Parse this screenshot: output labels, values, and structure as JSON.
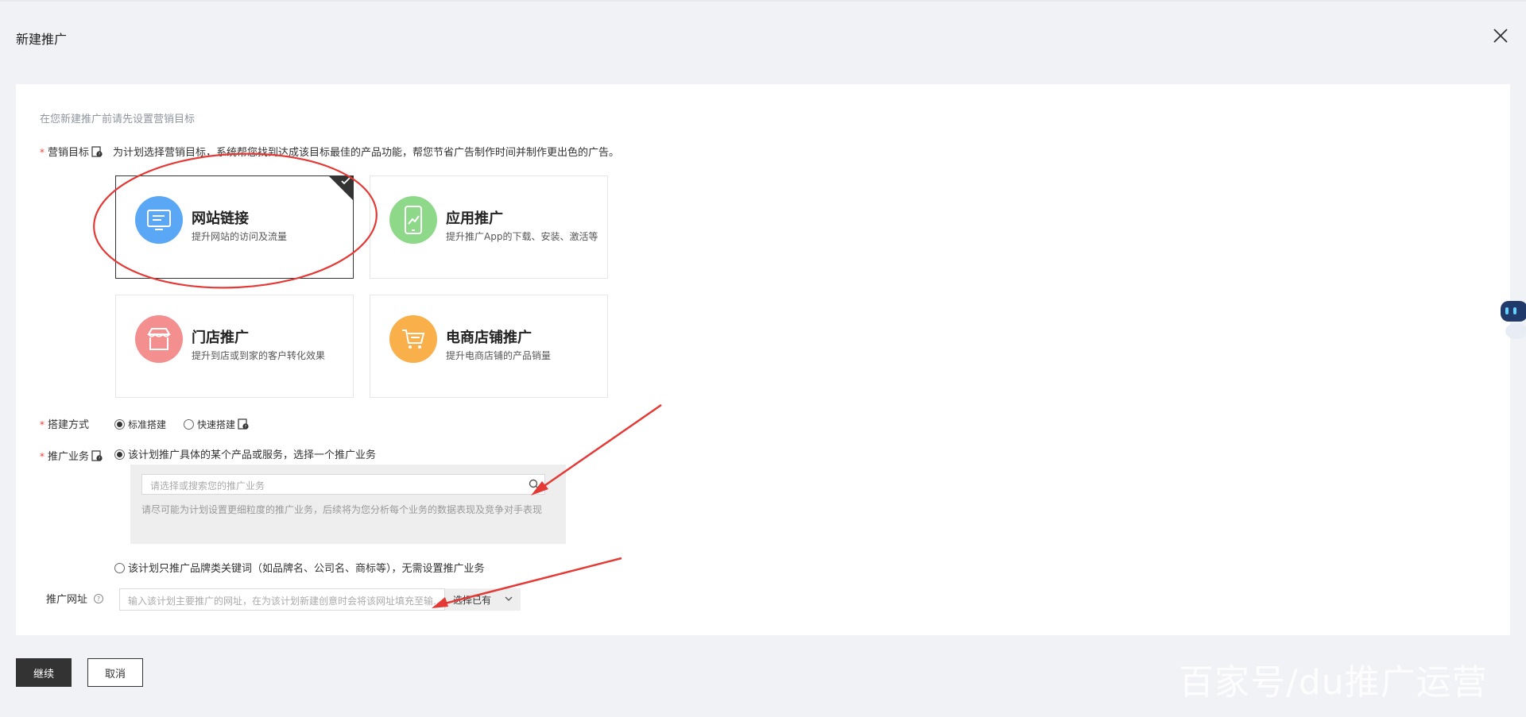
{
  "modal": {
    "title": "新建推广",
    "subtitle": "在您新建推广前请先设置营销目标"
  },
  "goal": {
    "label": "营销目标",
    "description": "为计划选择营销目标，系统帮您找到达成该目标最佳的产品功能，帮您节省广告制作时间并制作更出色的广告。",
    "cards": [
      {
        "title": "网站链接",
        "desc": "提升网站的访问及流量",
        "icon": "monitor-icon",
        "color": "#5aa7f5",
        "selected": true
      },
      {
        "title": "应用推广",
        "desc": "提升推广App的下载、安装、激活等",
        "icon": "mobile-icon",
        "color": "#8ed88a",
        "selected": false
      },
      {
        "title": "门店推广",
        "desc": "提升到店或到家的客户转化效果",
        "icon": "store-icon",
        "color": "#f48f8f",
        "selected": false
      },
      {
        "title": "电商店铺推广",
        "desc": "提升电商店铺的产品销量",
        "icon": "cart-icon",
        "color": "#f9b04a",
        "selected": false
      }
    ]
  },
  "build": {
    "label": "搭建方式",
    "options": [
      "标准搭建",
      "快速搭建"
    ],
    "selected": "标准搭建"
  },
  "business": {
    "label": "推广业务",
    "option1": "该计划推广具体的某个产品或服务，选择一个推广业务",
    "input_placeholder": "请选择或搜索您的推广业务",
    "hint": "请尽可能为计划设置更细粒度的推广业务，后续将为您分析每个业务的数据表现及竞争对手表现",
    "option2": "该计划只推广品牌类关键词（如品牌名、公司名、商标等），无需设置推广业务"
  },
  "url": {
    "label": "推广网址",
    "placeholder": "输入该计划主要推广的网址，在为该计划新建创意时会将该网址填充至输...",
    "select_label": "选择已有"
  },
  "buttons": {
    "continue": "继续",
    "cancel": "取消"
  },
  "watermark": "百家号/du推广运营",
  "colors": {
    "annotation_red": "#e53935",
    "primary_button": "#333333",
    "page_bg": "#f0f2f5"
  }
}
